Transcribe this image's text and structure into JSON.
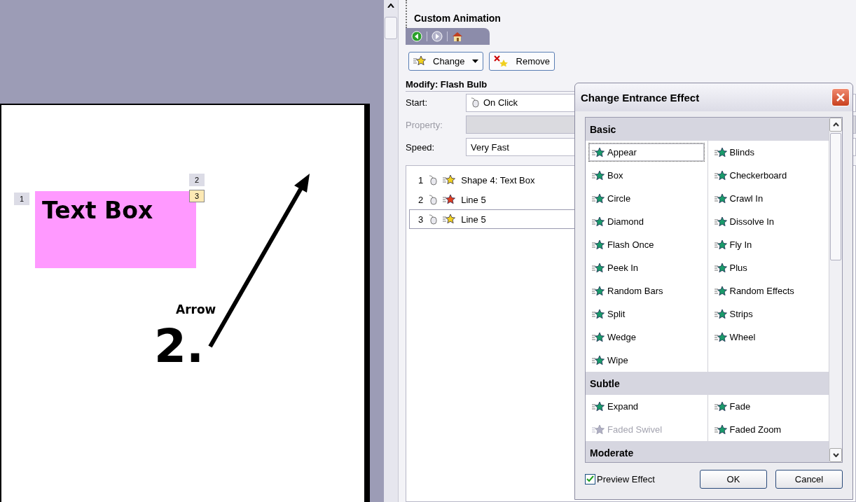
{
  "slide": {
    "text_box": "Text Box",
    "arrow_label": "Arrow",
    "step_label": "2.",
    "tags": [
      {
        "text": "1",
        "selected": false
      },
      {
        "text": "2",
        "selected": false
      },
      {
        "text": "3",
        "selected": true
      }
    ]
  },
  "task_pane": {
    "title": "Custom Animation",
    "nav": [
      {
        "kind": "back",
        "disabled": false
      },
      {
        "kind": "forward",
        "disabled": true
      },
      {
        "kind": "home",
        "disabled": false
      }
    ],
    "buttons": [
      {
        "label": "Change",
        "kind": "dropdown"
      },
      {
        "label": "Remove",
        "kind": "remove"
      }
    ],
    "section": "Modify: Flash Bulb",
    "fields": [
      {
        "label": "Start:",
        "value": "On Click",
        "kind": "trigger",
        "disabled": false
      },
      {
        "label": "Property:",
        "kind": "plain",
        "disabled": true
      },
      {
        "label": "Speed:",
        "value": "Very Fast",
        "kind": "plain",
        "disabled": false
      }
    ],
    "animations": [
      {
        "order": "1",
        "name": "Shape 4: Text Box",
        "color": "#f0d020",
        "selected": false
      },
      {
        "order": "2",
        "name": "Line 5",
        "color": "#e04020",
        "selected": false
      },
      {
        "order": "3",
        "name": "Line 5",
        "color": "#f0d020",
        "selected": true
      }
    ]
  },
  "dialog": {
    "title": "Change Entrance Effect",
    "groups": [
      {
        "name": "Basic",
        "effects": [
          {
            "label": "Appear",
            "selected": true,
            "disabled": false
          },
          {
            "label": "Blinds",
            "selected": false,
            "disabled": false
          },
          {
            "label": "Box",
            "selected": false,
            "disabled": false
          },
          {
            "label": "Checkerboard",
            "selected": false,
            "disabled": false
          },
          {
            "label": "Circle",
            "selected": false,
            "disabled": false
          },
          {
            "label": "Crawl In",
            "selected": false,
            "disabled": false
          },
          {
            "label": "Diamond",
            "selected": false,
            "disabled": false
          },
          {
            "label": "Dissolve In",
            "selected": false,
            "disabled": false
          },
          {
            "label": "Flash Once",
            "selected": false,
            "disabled": false
          },
          {
            "label": "Fly In",
            "selected": false,
            "disabled": false
          },
          {
            "label": "Peek In",
            "selected": false,
            "disabled": false
          },
          {
            "label": "Plus",
            "selected": false,
            "disabled": false
          },
          {
            "label": "Random Bars",
            "selected": false,
            "disabled": false
          },
          {
            "label": "Random Effects",
            "selected": false,
            "disabled": false
          },
          {
            "label": "Split",
            "selected": false,
            "disabled": false
          },
          {
            "label": "Strips",
            "selected": false,
            "disabled": false
          },
          {
            "label": "Wedge",
            "selected": false,
            "disabled": false
          },
          {
            "label": "Wheel",
            "selected": false,
            "disabled": false
          },
          {
            "label": "Wipe",
            "selected": false,
            "disabled": false
          }
        ]
      },
      {
        "name": "Subtle",
        "effects": [
          {
            "label": "Expand",
            "selected": false,
            "disabled": false
          },
          {
            "label": "Fade",
            "selected": false,
            "disabled": false
          },
          {
            "label": "Faded Swivel",
            "selected": false,
            "disabled": true
          },
          {
            "label": "Faded Zoom",
            "selected": false,
            "disabled": false
          }
        ]
      },
      {
        "name": "Moderate"
      }
    ],
    "preview": {
      "label": "Preview Effect",
      "checked": true
    },
    "buttons": [
      "OK",
      "Cancel"
    ]
  }
}
